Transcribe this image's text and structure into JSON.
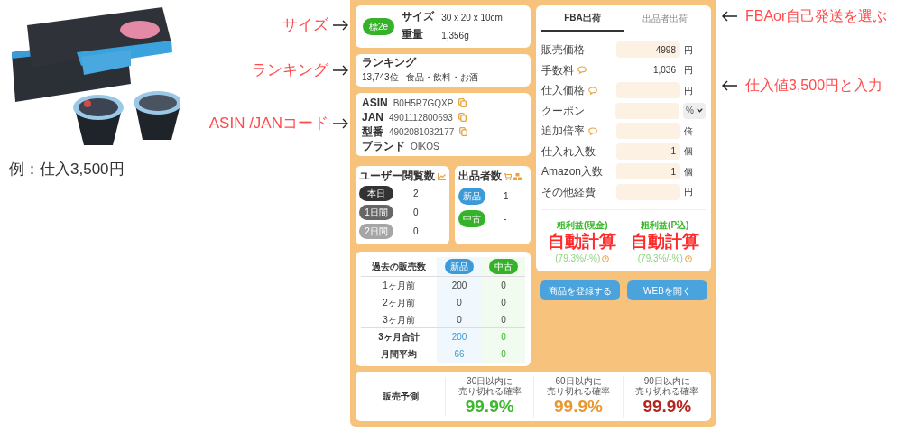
{
  "caption": "例：仕入3,500円",
  "annotations_left": [
    {
      "text": "サイズ"
    },
    {
      "text": "ランキング"
    },
    {
      "text": "ASIN /JANコード"
    }
  ],
  "annotations_right": [
    {
      "text": "FBAor自己発送を選ぶ"
    },
    {
      "text": "仕入値3,500円と入力"
    }
  ],
  "size_card": {
    "badge": "標2e",
    "rows": [
      {
        "label": "サイズ",
        "value": "30 x 20 x 10cm"
      },
      {
        "label": "重量",
        "value": "1,356g"
      }
    ]
  },
  "ranking": {
    "title": "ランキング",
    "value": "13,743位 | 食品・飲料・お酒"
  },
  "codes": [
    {
      "label": "ASIN",
      "value": "B0H5R7GQXP",
      "copy": true
    },
    {
      "label": "JAN",
      "value": "4901112800693",
      "copy": true
    },
    {
      "label": "型番",
      "value": "4902081032177",
      "copy": true
    },
    {
      "label": "ブランド",
      "value": "OIKOS",
      "copy": false
    }
  ],
  "views": {
    "title": "ユーザー閲覧数",
    "rows": [
      {
        "label": "本日",
        "value": "2",
        "color": "#333333"
      },
      {
        "label": "1日間",
        "value": "0",
        "color": "#666666"
      },
      {
        "label": "2日間",
        "value": "0",
        "color": "#a6a6a6"
      }
    ]
  },
  "sellers": {
    "title": "出品者数",
    "rows": [
      {
        "label": "新品",
        "value": "1",
        "color": "#3d9ad8"
      },
      {
        "label": "中古",
        "value": "-",
        "color": "#36b22a"
      }
    ]
  },
  "sales_history": {
    "title": "過去の販売数",
    "columns": [
      {
        "label": "新品",
        "color": "#3d9ad8"
      },
      {
        "label": "中古",
        "color": "#36b22a"
      }
    ],
    "rows": [
      {
        "label": "1ヶ月前",
        "values": [
          "200",
          "0"
        ],
        "summary": false
      },
      {
        "label": "2ヶ月前",
        "values": [
          "0",
          "0"
        ],
        "summary": false
      },
      {
        "label": "3ヶ月前",
        "values": [
          "0",
          "0"
        ],
        "summary": false
      },
      {
        "label": "3ヶ月合計",
        "values": [
          "200",
          "0"
        ],
        "summary": true
      },
      {
        "label": "月間平均",
        "values": [
          "66",
          "0"
        ],
        "summary": true
      }
    ]
  },
  "tabs": [
    {
      "label": "FBA出荷",
      "selected": true
    },
    {
      "label": "出品者出荷",
      "selected": false
    }
  ],
  "fields": [
    {
      "label": "販売価格",
      "kind": "input",
      "value": "4998",
      "unit": "円",
      "hint": false,
      "dropdown": false
    },
    {
      "label": "手数料",
      "kind": "text",
      "value": "1,036",
      "unit": "円",
      "hint": true,
      "dropdown": false
    },
    {
      "label": "仕入価格",
      "kind": "input",
      "unit": "円",
      "hint": true,
      "dropdown": false
    },
    {
      "label": "クーポン",
      "kind": "input",
      "unit": "%",
      "hint": false,
      "dropdown": true
    },
    {
      "label": "追加倍率",
      "kind": "input",
      "unit": "倍",
      "hint": true,
      "dropdown": false
    },
    {
      "label": "仕入れ入数",
      "kind": "input",
      "value": "1",
      "unit": "個",
      "hint": false,
      "dropdown": false
    },
    {
      "label": "Amazon入数",
      "kind": "input",
      "value": "1",
      "unit": "個",
      "hint": false,
      "dropdown": false
    },
    {
      "label": "その他経費",
      "kind": "input",
      "unit": "円",
      "hint": false,
      "dropdown": false
    }
  ],
  "profit": [
    {
      "title": "粗利益(現金)",
      "overlay": "自動計算",
      "ratio": "(79.3%/-%)"
    },
    {
      "title": "粗利益(P込)",
      "overlay": "自動計算",
      "ratio": "(79.3%/-%)"
    }
  ],
  "buttons": [
    "商品を登録する",
    "WEBを開く"
  ],
  "forecast": {
    "title": "販売予測",
    "items": [
      {
        "lines": [
          "30日以内に",
          "売り切れる確率"
        ],
        "value": "99.9%",
        "color": "#3bb82b"
      },
      {
        "lines": [
          "60日以内に",
          "売り切れる確率"
        ],
        "value": "99.9%",
        "color": "#e8982f"
      },
      {
        "lines": [
          "90日以内に",
          "売り切れる確率"
        ],
        "value": "99.9%",
        "color": "#b3261e"
      }
    ]
  }
}
